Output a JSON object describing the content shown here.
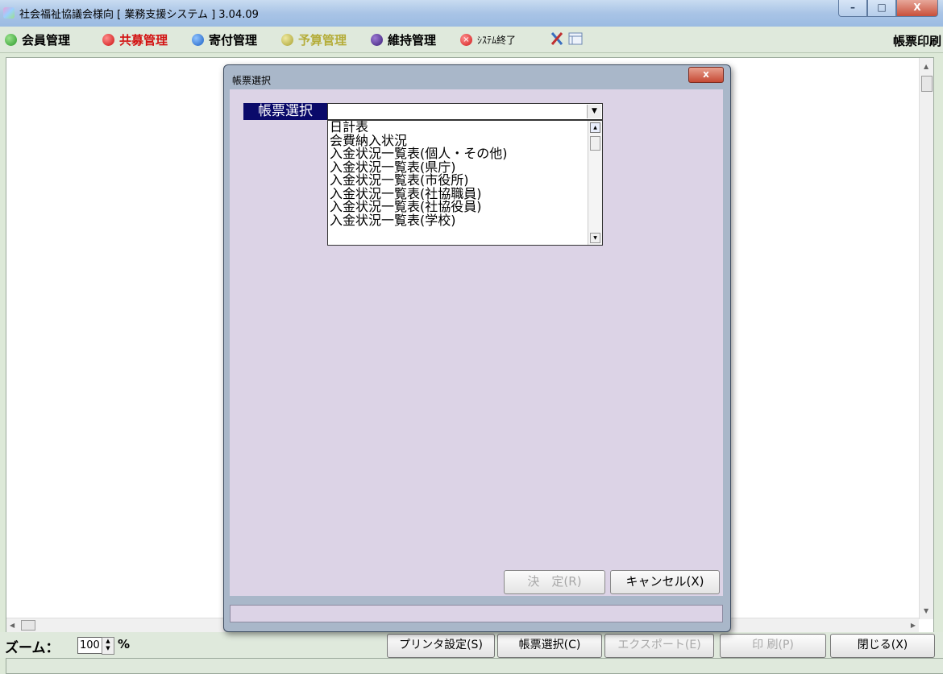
{
  "window": {
    "title": "社会福祉協議会様向 [ 業務支援システム ] 3.04.09",
    "min_glyph": "–",
    "max_glyph": "□",
    "close_glyph": "X"
  },
  "menubar": {
    "items": [
      {
        "label": "会員管理",
        "color": "#3aa33a"
      },
      {
        "label": "共募管理",
        "color": "#e02020"
      },
      {
        "label": "寄付管理",
        "color": "#2a6fd0"
      },
      {
        "label": "予算管理",
        "color": "#c7c04a"
      },
      {
        "label": "維持管理",
        "color": "#4a2a8a"
      },
      {
        "label": "ｼｽﾃﾑ終了",
        "color": "#e03a3a"
      }
    ],
    "right_label": "帳票印刷"
  },
  "bottombar": {
    "zoom_label": "ズーム：",
    "zoom_value": "100",
    "zoom_unit": "%",
    "buttons": {
      "printer_settings": "プリンタ設定(S)",
      "report_select": "帳票選択(C)",
      "export": "エクスポート(E)",
      "print": "印 刷(P)",
      "close": "閉じる(X)"
    }
  },
  "dialog": {
    "title": "帳票選択",
    "close_glyph": "x",
    "field_label": "帳票選択",
    "combo_value": "",
    "list_items": [
      "日計表",
      "会費納入状況",
      "入金状況一覧表(個人・その他)",
      "入金状況一覧表(県庁)",
      "入金状況一覧表(市役所)",
      "入金状況一覧表(社協職員)",
      "入金状況一覧表(社協役員)",
      "入金状況一覧表(学校)"
    ],
    "ok_label": "決　定(R)",
    "cancel_label": "キャンセル(X)"
  }
}
